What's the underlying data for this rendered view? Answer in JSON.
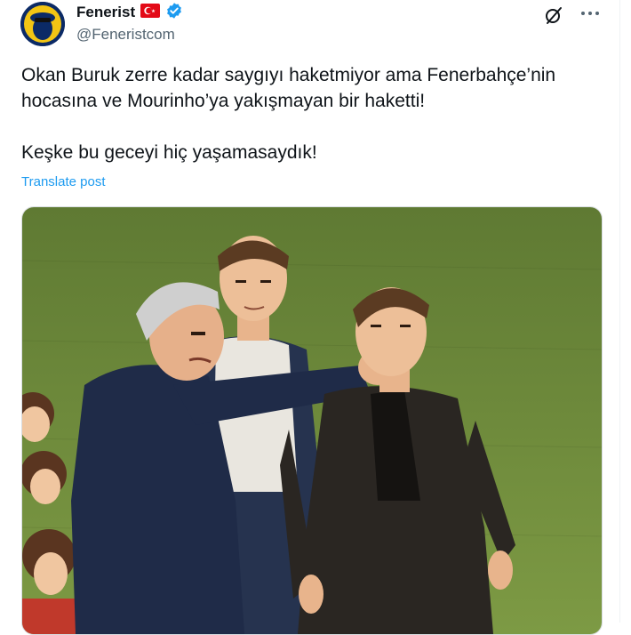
{
  "account": {
    "display_name": "Fenerist",
    "handle": "@Feneristcom",
    "flag_icon": "turkey-flag-icon",
    "verified_icon": "verified-badge-icon",
    "verified_color": "#1d9bf0"
  },
  "post": {
    "line1": "Okan Buruk zerre kadar saygıyı haketmiyor ama Fenerbahçe’nin",
    "line2": "hocasına ve Mourinho’ya yakışmayan bir haketti!",
    "line3": "Keşke bu geceyi hiç yaşamasaydık!",
    "translate_label": "Translate post"
  },
  "actions": {
    "grok_icon": "grok-icon",
    "more_icon": "more-dots-icon"
  },
  "media": {
    "type": "illustration",
    "accent_grass": "#6f8a3a"
  }
}
